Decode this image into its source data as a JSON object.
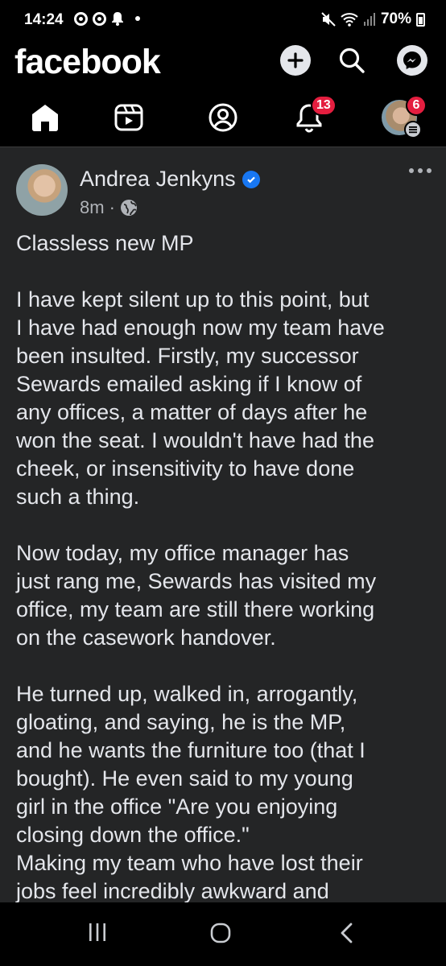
{
  "status_bar": {
    "time": "14:24",
    "battery": "70%",
    "icons_left": [
      "chrome-icon",
      "chrome-icon",
      "bell-icon",
      "dot"
    ],
    "icons_right": [
      "mute-icon",
      "wifi-icon",
      "signal-icon",
      "battery-icon"
    ]
  },
  "header": {
    "logo": "facebook",
    "buttons": [
      "add-icon",
      "search-icon",
      "messenger-icon"
    ]
  },
  "nav": {
    "items": [
      "home",
      "video",
      "profile",
      "notifications",
      "menu"
    ],
    "notifications_badge": "13",
    "menu_badge": "6"
  },
  "post": {
    "author": "Andrea Jenkyns",
    "time": "8m",
    "audience": "public-globe-icon",
    "paragraphs": [
      [
        "Classless new MP"
      ],
      [
        "I have kept silent up to this point, but",
        "I have had enough now my team have",
        "been insulted. Firstly, my successor",
        "Sewards emailed asking if I know of",
        "any offices, a matter of days after he",
        "won the seat. I wouldn't have had the",
        "cheek, or insensitivity to have done",
        "such a thing."
      ],
      [
        "Now today, my office manager has",
        "just rang me, Sewards has visited my",
        "office, my team are still there working",
        "on the casework handover."
      ],
      [
        "He turned up, walked in, arrogantly,",
        "gloating, and saying, he  is the MP,",
        "and he wants the furniture too (that I",
        "bought). He even said to my young",
        "girl in the office \"Are you enjoying",
        "closing down the office.\"",
        "Making my team who have lost their",
        "jobs feel incredibly awkward and"
      ]
    ]
  },
  "colors": {
    "background": "#000000",
    "card": "#242526",
    "text": "#e4e6eb",
    "secondary": "#b0b3b8",
    "badge": "#e41e3f",
    "verified": "#1877f2"
  }
}
